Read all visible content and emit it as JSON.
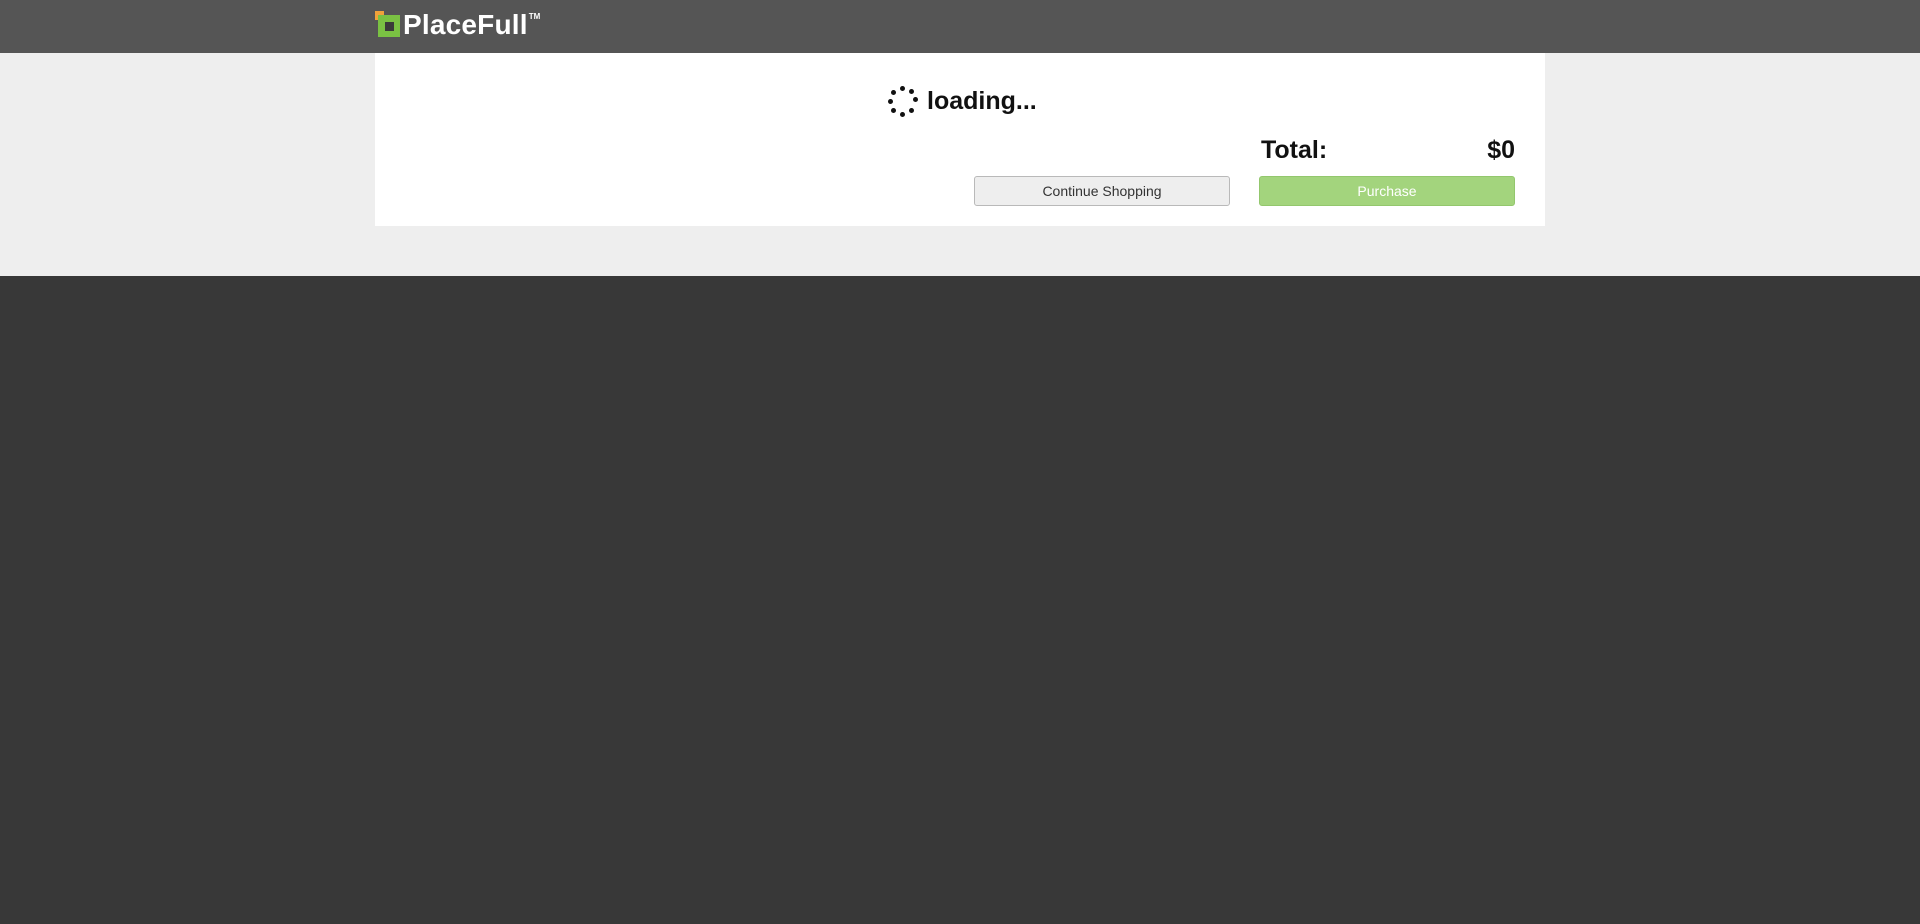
{
  "header": {
    "brand": "PlaceFull",
    "trademark": "TM",
    "logo_colors": {
      "orange": "#f0a23a",
      "green": "#7ac143"
    }
  },
  "checkout": {
    "loading_text": "loading...",
    "total_label": "Total:",
    "total_value": "$0",
    "continue_label": "Continue Shopping",
    "purchase_label": "Purchase"
  },
  "colors": {
    "header_bg": "#555555",
    "band_bg": "#eeeeee",
    "footer_bg": "#383838",
    "purchase_bg": "#a3d47d"
  }
}
